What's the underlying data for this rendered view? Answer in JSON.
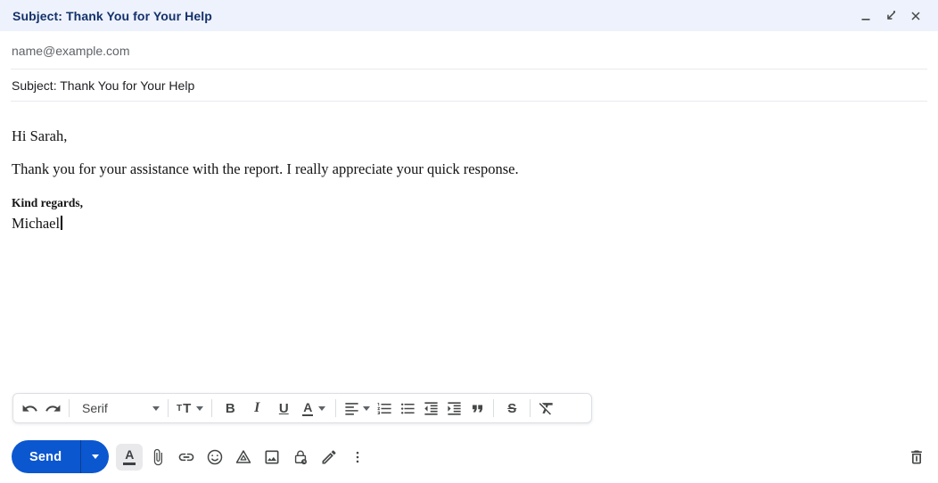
{
  "window": {
    "title": "Subject: Thank You for Your Help"
  },
  "fields": {
    "recipients": "name@example.com",
    "subject": "Subject: Thank You for Your Help"
  },
  "body": {
    "greeting": "Hi Sarah,",
    "paragraph": "Thank you for your assistance with the report. I really appreciate your quick response.",
    "signoff": "Kind regards,",
    "signature": "Michael"
  },
  "format_toolbar": {
    "font_family": "Serif",
    "size_small": "T",
    "size_big": "T",
    "bold": "B",
    "italic": "I",
    "underline": "U",
    "text_color": "A",
    "strikethrough": "S"
  },
  "action_bar": {
    "send": "Send",
    "formatting_letter": "A"
  },
  "icons": {
    "minimize-icon": "—",
    "exit-fullscreen-icon": "⇙",
    "close-icon": "✕",
    "undo-icon": "↺",
    "redo-icon": "↻",
    "font-dropdown-arrow-icon": "▾",
    "size-dropdown-arrow-icon": "▾",
    "text-color-dropdown-arrow-icon": "▾",
    "align-icon": "≡",
    "align-dropdown-arrow-icon": "▾",
    "numbered-list-icon": "1.",
    "bulleted-list-icon": "•",
    "indent-decrease-icon": "⇤",
    "indent-increase-icon": "⇥",
    "quote-icon": "❞",
    "remove-formatting-icon": "T̸",
    "attach-icon": "📎",
    "link-icon": "🔗",
    "emoji-icon": "☺",
    "drive-icon": "△",
    "image-icon": "🖼",
    "confidential-lock-icon": "🔒",
    "signature-pen-icon": "✎",
    "more-options-icon": "⋮",
    "send-dropdown-arrow-icon": "▾",
    "trash-icon": "🗑"
  },
  "colors": {
    "header_bg": "#eef2fc",
    "header_text": "#14316b",
    "send_bg": "#0b57d0",
    "icon": "#444746",
    "muted_text": "#5f6368",
    "divider": "#e9eaee"
  }
}
